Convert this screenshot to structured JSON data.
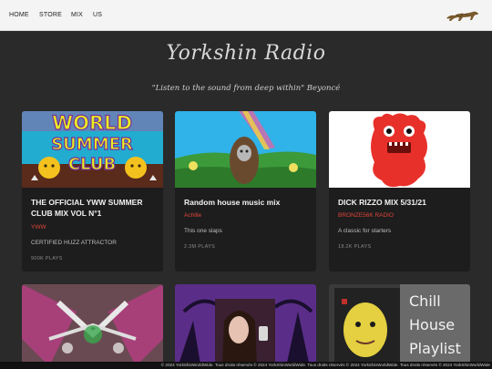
{
  "nav": {
    "links": [
      "HOME",
      "STORE",
      "MIX",
      "US"
    ]
  },
  "hero": {
    "title": "Yorkshin Radio",
    "quote": "\"Listen to the sound from deep within\" Beyoncé"
  },
  "cards": [
    {
      "title": "THE OFFICIAL YWW SUMMER CLUB MIX VOL N°1",
      "artist": "YWW",
      "description": "CERTIFIED HUZZ ATTRACTOR",
      "plays": "900K PLAYS",
      "image_text": [
        "WORLD",
        "SUMMER",
        "CLUB"
      ]
    },
    {
      "title": "Random house music mix",
      "artist": "Achille",
      "description": "This one slaps",
      "plays": "2.3M PLAYS"
    },
    {
      "title": "DICK RIZZO MIX 5/31/21",
      "artist": "BRONZE56K RADIO",
      "description": "A classic for starters",
      "plays": "18.2K PLAYS"
    }
  ],
  "row2": {
    "card6_text": [
      "Chill",
      "House",
      "Playlist"
    ]
  },
  "footer": {
    "text": "© 2024 YorkShinWorldWide. Tous droits réservés © 2024 YorkShinWorldWide. Tous droits réservés © 2024 YorkShinWorldWide. Tous droits réservés © 2024 YorkShinWorldWide"
  },
  "colors": {
    "accent": "#e0453a",
    "background": "#2a2a2a",
    "card": "#1d1d1d"
  }
}
